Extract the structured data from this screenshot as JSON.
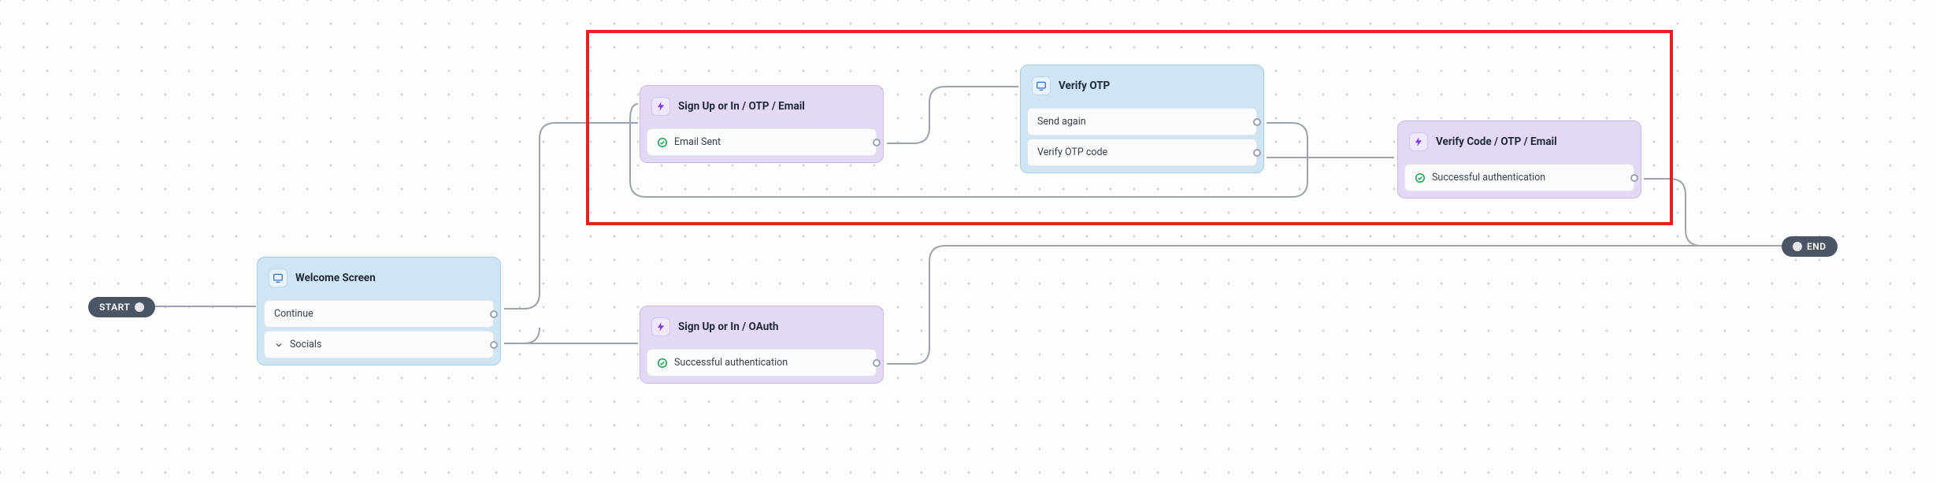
{
  "pills": {
    "start": "START",
    "end": "END"
  },
  "nodes": {
    "welcome": {
      "title": "Welcome Screen",
      "rows": {
        "continue": "Continue",
        "socials": "Socials"
      }
    },
    "signup_otp": {
      "title": "Sign Up or In / OTP / Email",
      "rows": {
        "email_sent": "Email Sent"
      }
    },
    "signup_oauth": {
      "title": "Sign Up or In / OAuth",
      "rows": {
        "success": "Successful authentication"
      }
    },
    "verify_otp": {
      "title": "Verify OTP",
      "rows": {
        "send_again": "Send again",
        "verify_code": "Verify OTP code"
      }
    },
    "verify_code_email": {
      "title": "Verify Code / OTP / Email",
      "rows": {
        "success": "Successful authentication"
      }
    }
  }
}
